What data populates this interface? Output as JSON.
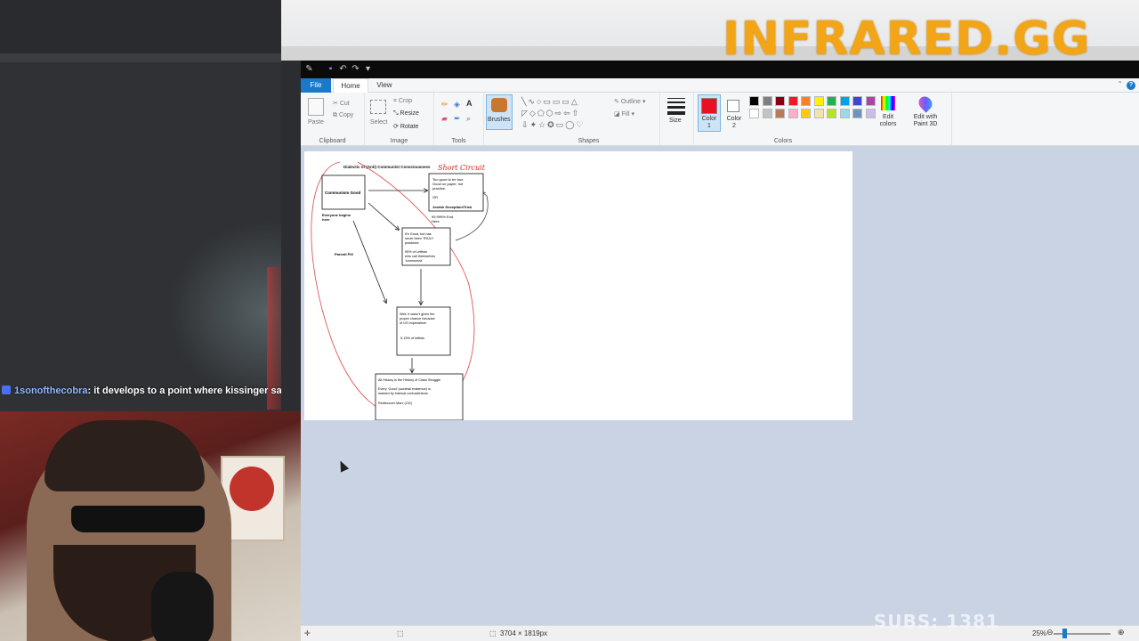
{
  "overlay": {
    "logo_text": "INFRARED.GG",
    "subs_text": "SUBS: 1381",
    "accent": "#f2a516"
  },
  "chat": {
    "username": "1sonofthecobra",
    "message": ": it develops to a point where kissinger save"
  },
  "paint": {
    "tabs": [
      "File",
      "Home",
      "View"
    ],
    "groups": {
      "clipboard": {
        "label": "Clipboard",
        "paste": "Paste",
        "cut": "Cut",
        "copy": "Copy"
      },
      "image": {
        "label": "Image",
        "select": "Select",
        "crop": "Crop",
        "resize": "Resize",
        "rotate": "Rotate"
      },
      "tools": {
        "label": "Tools"
      },
      "brushes": {
        "label": "Brushes"
      },
      "shapes": {
        "label": "Shapes",
        "outline": "Outline",
        "fill": "Fill"
      },
      "size": {
        "label": "Size"
      },
      "colors": {
        "label": "Colors",
        "color1": "Color 1",
        "color2": "Color 2",
        "edit_colors": "Edit colors",
        "paint3d": "Edit with Paint 3D",
        "color1_value": "#e81123",
        "color2_value": "#ffffff",
        "palette_row1": [
          "#000000",
          "#7f7f7f",
          "#880015",
          "#ed1c24",
          "#ff7f27",
          "#fff200",
          "#22b14c",
          "#00a2e8",
          "#3f48cc",
          "#a349a4"
        ],
        "palette_row2": [
          "#ffffff",
          "#c3c3c3",
          "#b97a57",
          "#ffaec9",
          "#ffc90e",
          "#efe4b0",
          "#b5e61d",
          "#99d9ea",
          "#7092be",
          "#c8bfe7"
        ]
      }
    },
    "status": {
      "dimensions": "3704 × 1819px",
      "zoom": "25%"
    },
    "drawing": {
      "title": "Dialectic of (Anti) Communist Consciousness",
      "handwritten": "Short Circuit",
      "box1": "Communism Good",
      "begins": [
        "Everyone begins",
        "here"
      ],
      "box2": [
        "Too good to be true.",
        "Good on paper, not",
        "practice.",
        "",
        "OR",
        "",
        "Jewish Deception/Trick"
      ],
      "end": [
        "99.999% End",
        "Here"
      ],
      "box3": [
        "It's Good, but has",
        "never been TRULY",
        "practiced.",
        "",
        "95% of Leftists",
        "who call themselves",
        "'communist'"
      ],
      "parenti": "Parenti Pill",
      "box4": [
        "Well, it wasn't given the",
        "proper chance because",
        "of US Imperialism",
        "",
        "",
        "5-15% of leftists"
      ],
      "box5": [
        "All History is the History of Class Struggle",
        "",
        "Every 'Good' (societal existence) is",
        "marked by internal contradictions",
        "",
        "Rediscover Marx (OG)"
      ]
    }
  }
}
